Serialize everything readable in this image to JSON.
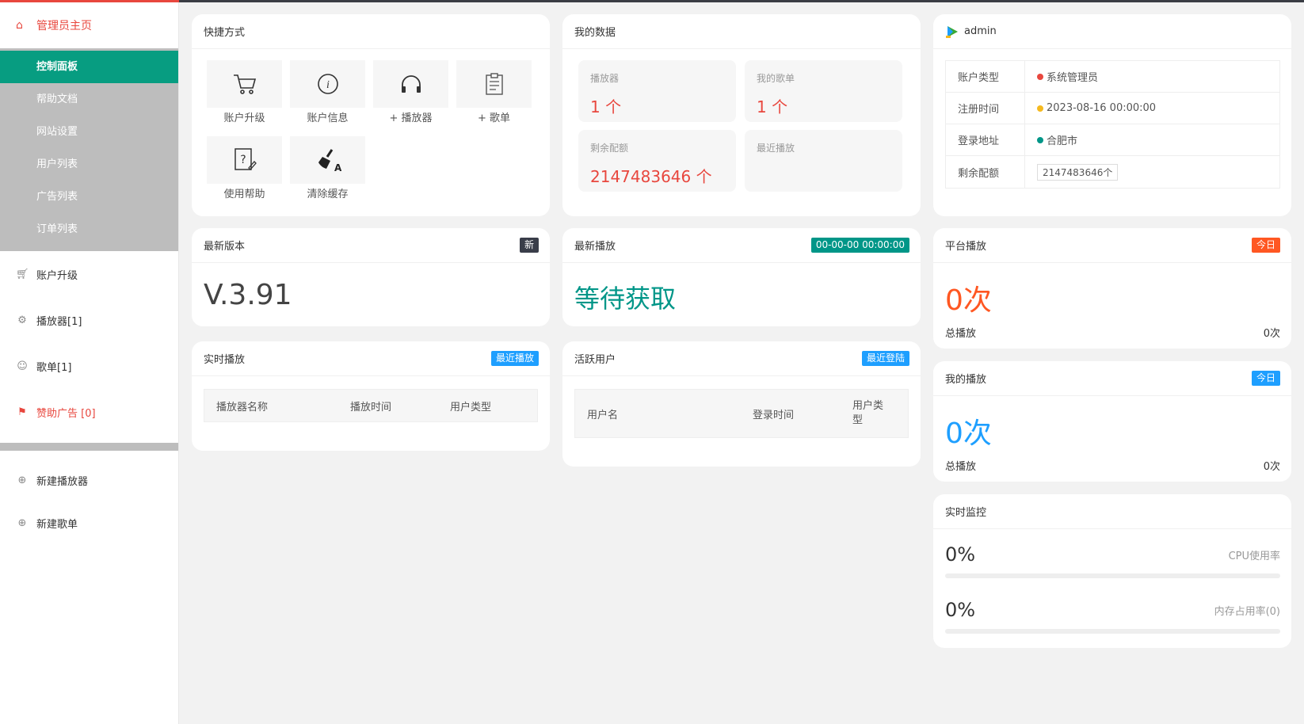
{
  "sidebar": {
    "home": "管理员主页",
    "group": [
      "控制面板",
      "帮助文档",
      "网站设置",
      "用户列表",
      "广告列表",
      "订单列表"
    ],
    "items": [
      {
        "label": "账户升级",
        "icon": "cart-icon"
      },
      {
        "label": "播放器[1]",
        "icon": "gear-icon"
      },
      {
        "label": "歌单[1]",
        "icon": "user-icon"
      },
      {
        "label": "赞助广告 [0]",
        "icon": "flag-icon"
      }
    ],
    "items2": [
      {
        "label": "新建播放器",
        "icon": "plus-circle-icon"
      },
      {
        "label": "新建歌单",
        "icon": "plus-circle-icon"
      }
    ]
  },
  "quick": {
    "title": "快捷方式",
    "tiles": [
      {
        "label": "账户升级",
        "icon": "cart-icon"
      },
      {
        "label": "账户信息",
        "icon": "info-icon"
      },
      {
        "label": "+ 播放器",
        "icon": "headphones-icon"
      },
      {
        "label": "+ 歌单",
        "icon": "clipboard-icon"
      },
      {
        "label": "使用帮助",
        "icon": "help-doc-icon"
      },
      {
        "label": "清除缓存",
        "icon": "broom-icon"
      }
    ]
  },
  "mydata": {
    "title": "我的数据",
    "stats": [
      {
        "label": "播放器",
        "value": "1 个"
      },
      {
        "label": "我的歌单",
        "value": "1 个"
      },
      {
        "label": "剩余配额",
        "value": "2147483646 个"
      },
      {
        "label": "最近播放",
        "value": ""
      }
    ]
  },
  "admin": {
    "name": "admin",
    "rows": [
      {
        "key": "账户类型",
        "value": "系统管理员",
        "dot": "#e8473e"
      },
      {
        "key": "注册时间",
        "value": "2023-08-16 00:00:00",
        "dot": "#f5b91f"
      },
      {
        "key": "登录地址",
        "value": "合肥市",
        "dot": "#009688"
      },
      {
        "key": "剩余配额",
        "value": "2147483646个"
      }
    ]
  },
  "version": {
    "title": "最新版本",
    "badge": "新",
    "value": "V.3.91"
  },
  "latest_play": {
    "title": "最新播放",
    "badge": "00-00-00 00:00:00",
    "value": "等待获取"
  },
  "platform_play": {
    "title": "平台播放",
    "badge": "今日",
    "value": "0次",
    "total_label": "总播放",
    "total_value": "0次"
  },
  "my_play": {
    "title": "我的播放",
    "badge": "今日",
    "value": "0次",
    "total_label": "总播放",
    "total_value": "0次"
  },
  "realtime_play": {
    "title": "实时播放",
    "badge": "最近播放",
    "cols": [
      "播放器名称",
      "播放时间",
      "用户类型"
    ]
  },
  "active_users": {
    "title": "活跃用户",
    "badge": "最近登陆",
    "cols": [
      "用户名",
      "登录时间",
      "用户类型"
    ]
  },
  "monitor": {
    "title": "实时监控",
    "cpu": {
      "value": "0%",
      "label": "CPU使用率",
      "fraction": 0
    },
    "mem": {
      "value": "0%",
      "label": "内存占用率(0)",
      "fraction": 0
    }
  },
  "colors": {
    "accent": "#009688",
    "red": "#e8473e",
    "orange": "#ff5722",
    "blue": "#1e9fff"
  }
}
